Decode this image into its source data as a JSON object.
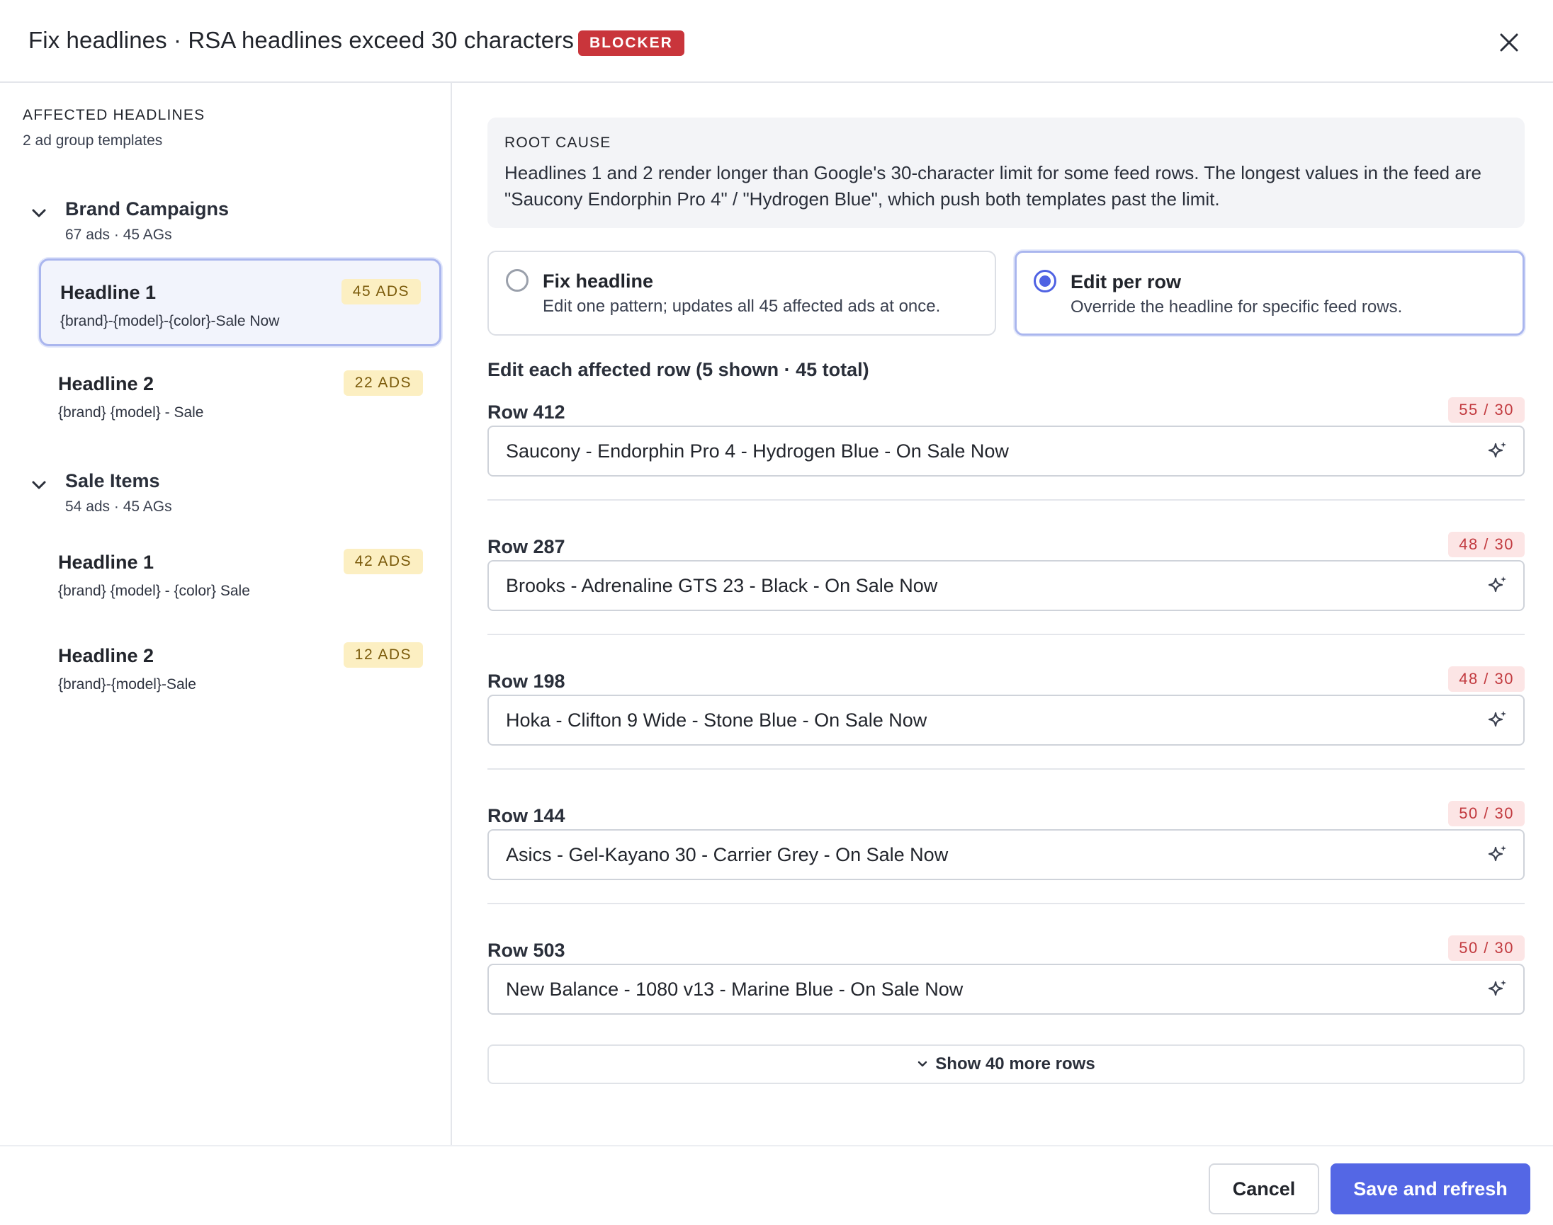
{
  "header": {
    "title": "Fix headlines · RSA headlines exceed 30 characters",
    "badge": "BLOCKER",
    "close_icon": "close-icon"
  },
  "left": {
    "section_label": "AFFECTED HEADLINES",
    "section_sub": "2 ad group templates",
    "groups": [
      {
        "name": "Brand Campaigns",
        "meta": "67 ads · 45 AGs",
        "headlines": [
          {
            "name": "Headline 1",
            "pattern": "{brand}-{model}-{color}-Sale Now",
            "ads": "45 ADS",
            "selected": true
          },
          {
            "name": "Headline 2",
            "pattern": "{brand} {model} - Sale",
            "ads": "22 ADS",
            "selected": false
          }
        ]
      },
      {
        "name": "Sale Items",
        "meta": "54 ads · 45 AGs",
        "headlines": [
          {
            "name": "Headline 1",
            "pattern": "{brand} {model} - {color} Sale",
            "ads": "42 ADS",
            "selected": false
          },
          {
            "name": "Headline 2",
            "pattern": "{brand}-{model}-Sale",
            "ads": "12 ADS",
            "selected": false
          }
        ]
      }
    ]
  },
  "root_cause": {
    "label": "ROOT CAUSE",
    "text": "Headlines 1 and 2 render longer than Google's 30-character limit for some feed rows. The longest values in the feed are \"Saucony Endorphin Pro 4\" / \"Hydrogen Blue\", which push both templates past the limit."
  },
  "options": [
    {
      "title": "Fix headline",
      "desc": "Edit one pattern; updates all 45 affected ads at once.",
      "selected": false
    },
    {
      "title": "Edit per row",
      "desc": "Override the headline for specific feed rows.",
      "selected": true
    }
  ],
  "rows_heading": "Edit each affected row (5 shown · 45 total)",
  "rows": [
    {
      "label": "Row 412",
      "count": "55 / 30",
      "value": "Saucony - Endorphin Pro 4 - Hydrogen Blue - On Sale Now"
    },
    {
      "label": "Row 287",
      "count": "48 / 30",
      "value": "Brooks - Adrenaline GTS 23 - Black - On Sale Now"
    },
    {
      "label": "Row 198",
      "count": "48 / 30",
      "value": "Hoka - Clifton 9 Wide - Stone Blue - On Sale Now"
    },
    {
      "label": "Row 144",
      "count": "50 / 30",
      "value": "Asics - Gel-Kayano 30 - Carrier Grey - On Sale Now"
    },
    {
      "label": "Row 503",
      "count": "50 / 30",
      "value": "New Balance - 1080 v13 - Marine Blue - On Sale Now"
    }
  ],
  "show_more": "Show 40 more rows",
  "footer": {
    "cancel": "Cancel",
    "save": "Save and refresh"
  },
  "colors": {
    "accent": "#5467e5",
    "blocker": "#c9353b",
    "ads_badge_bg": "#fcefc2",
    "count_badge_bg": "#fce5e5"
  }
}
